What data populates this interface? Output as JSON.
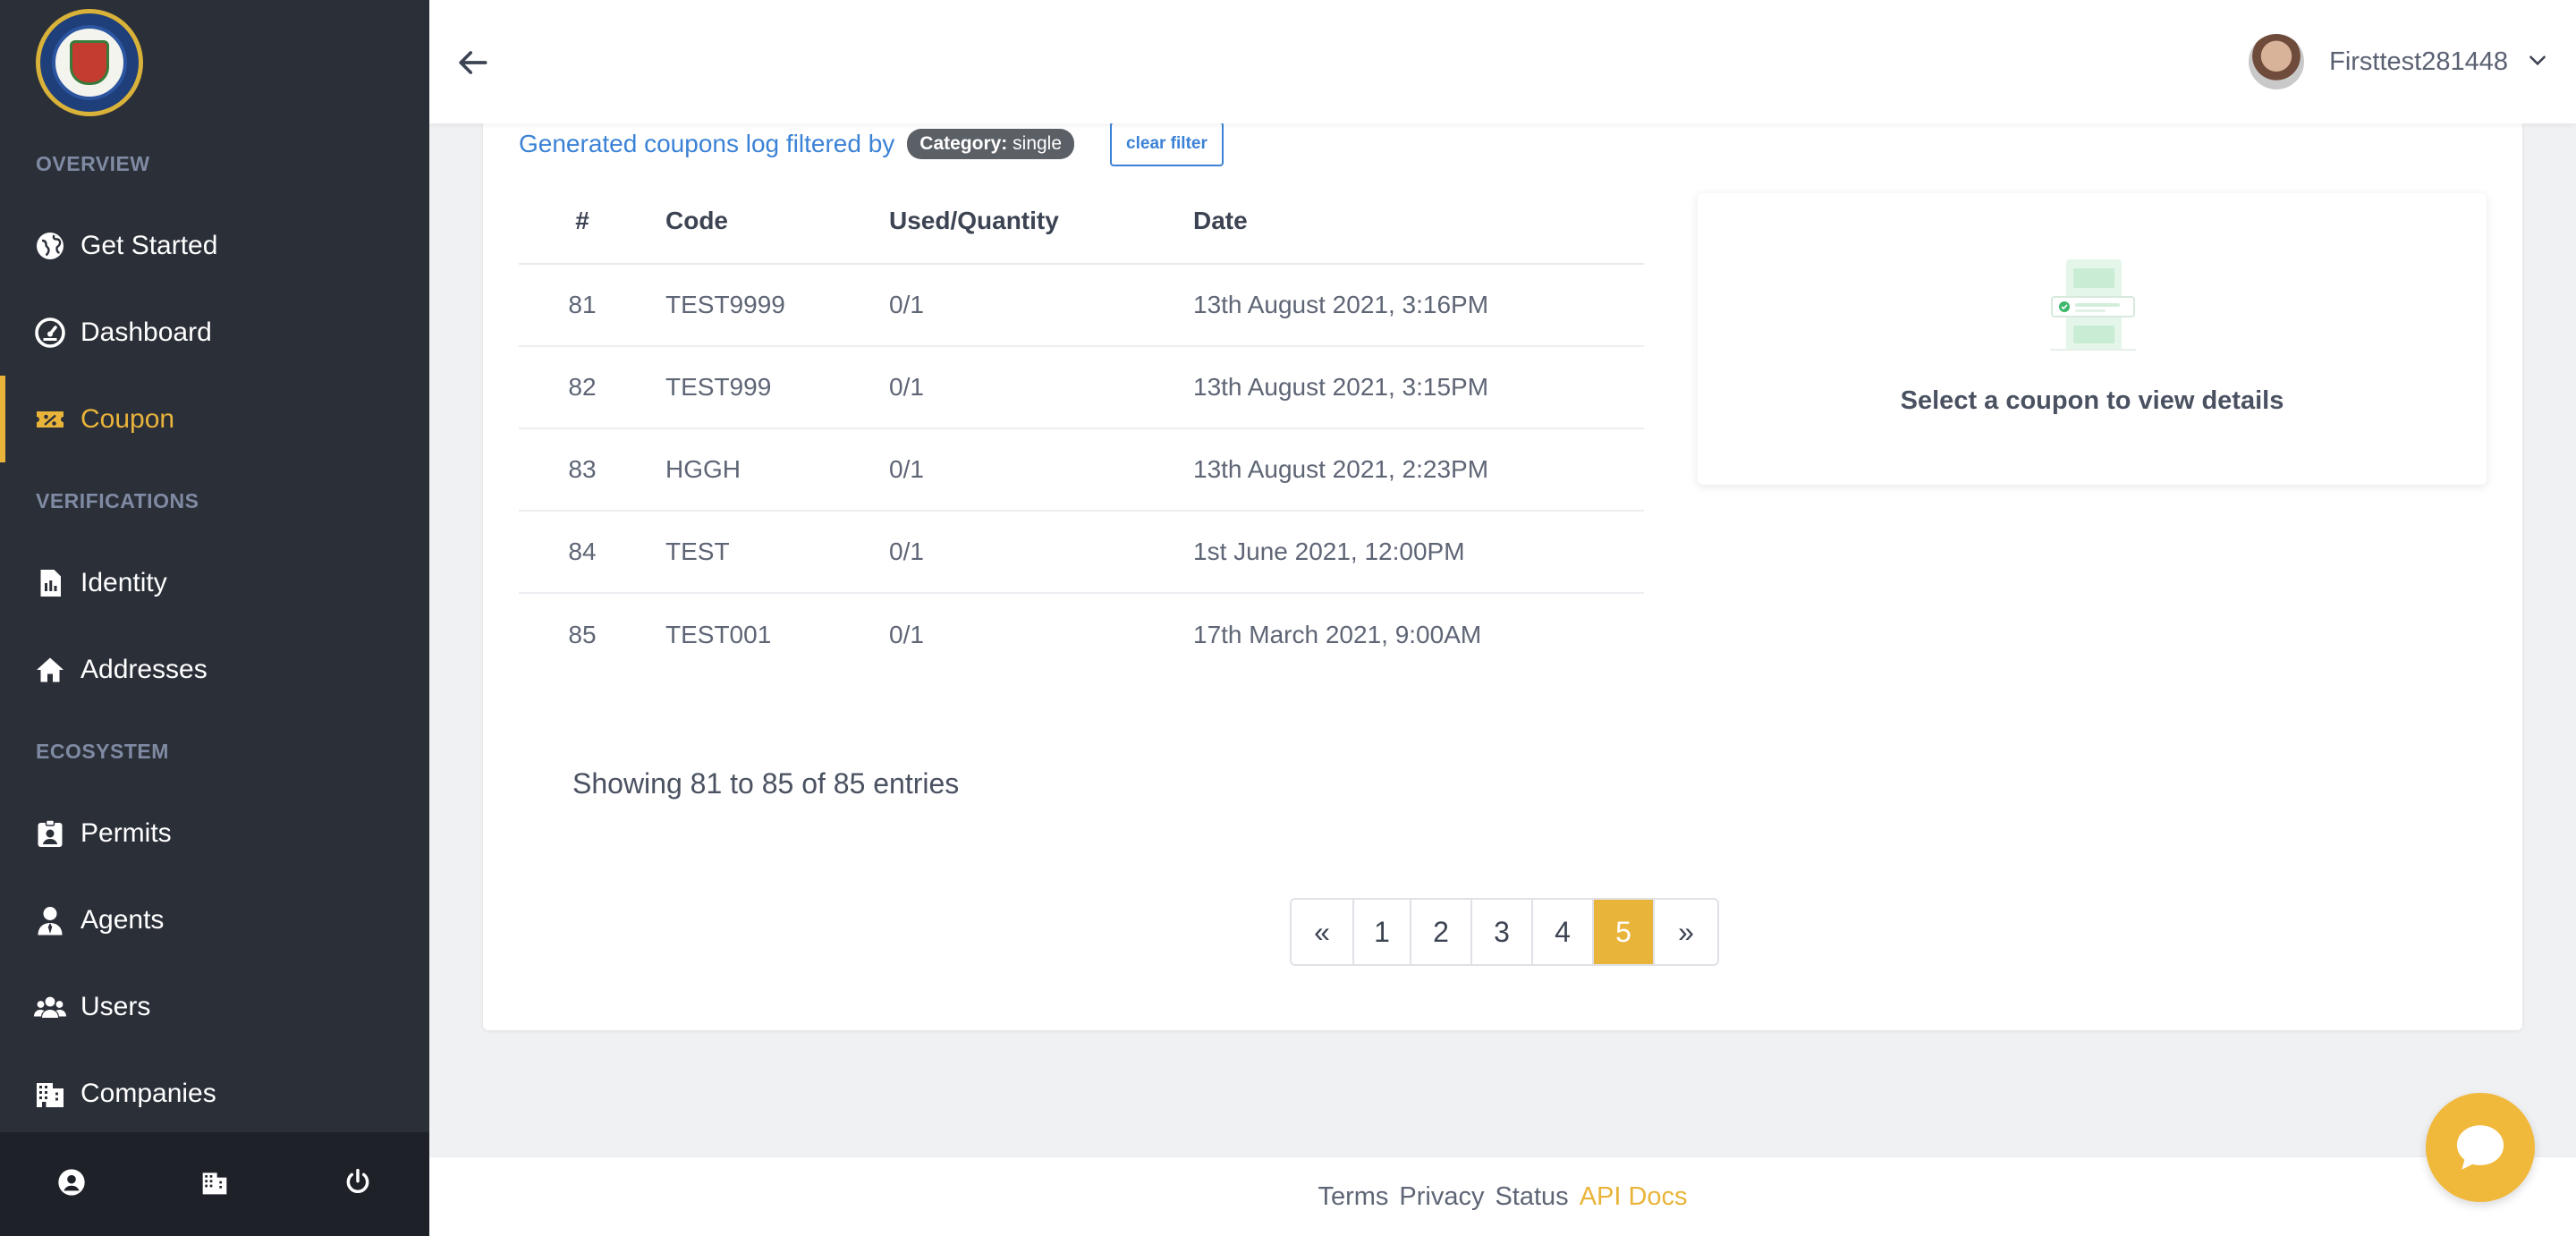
{
  "sidebar": {
    "sections": [
      {
        "label": "OVERVIEW"
      },
      {
        "label": "VERIFICATIONS"
      },
      {
        "label": "ECOSYSTEM"
      }
    ],
    "items": [
      {
        "label": "Get Started",
        "icon": "globe-icon"
      },
      {
        "label": "Dashboard",
        "icon": "gauge-icon"
      },
      {
        "label": "Coupon",
        "icon": "ticket-icon",
        "active": true
      },
      {
        "label": "Identity",
        "icon": "id-file-icon"
      },
      {
        "label": "Addresses",
        "icon": "home-icon"
      },
      {
        "label": "Permits",
        "icon": "badge-icon"
      },
      {
        "label": "Agents",
        "icon": "agent-icon"
      },
      {
        "label": "Users",
        "icon": "users-icon"
      },
      {
        "label": "Companies",
        "icon": "building-icon"
      }
    ],
    "footer_icons": [
      "user-circle-icon",
      "building-icon",
      "power-icon"
    ]
  },
  "topbar": {
    "user_name": "Firsttest281448"
  },
  "filter": {
    "text": "Generated coupons log filtered by",
    "badge_key": "Category:",
    "badge_value": "single",
    "clear_label": "clear filter"
  },
  "table": {
    "headers": [
      "#",
      "Code",
      "Used/Quantity",
      "Date"
    ],
    "rows": [
      {
        "num": "81",
        "code": "TEST9999",
        "used": "0/1",
        "date": "13th August 2021, 3:16PM"
      },
      {
        "num": "82",
        "code": "TEST999",
        "used": "0/1",
        "date": "13th August 2021, 3:15PM"
      },
      {
        "num": "83",
        "code": "HGGH",
        "used": "0/1",
        "date": "13th August 2021, 2:23PM"
      },
      {
        "num": "84",
        "code": "TEST",
        "used": "0/1",
        "date": "1st June 2021, 12:00PM"
      },
      {
        "num": "85",
        "code": "TEST001",
        "used": "0/1",
        "date": "17th March 2021, 9:00AM"
      }
    ]
  },
  "showing": "Showing 81 to 85 of 85 entries",
  "pagination": {
    "prev": "«",
    "pages": [
      "1",
      "2",
      "3",
      "4",
      "5"
    ],
    "active_page": "5",
    "next": "»"
  },
  "detail": {
    "message": "Select a coupon to view details"
  },
  "footer": {
    "links": [
      "Terms",
      "Privacy",
      "Status",
      "API Docs"
    ]
  },
  "colors": {
    "accent": "#e9b43a",
    "link": "#3b82d6",
    "sidebar_bg": "#2b2f38"
  }
}
